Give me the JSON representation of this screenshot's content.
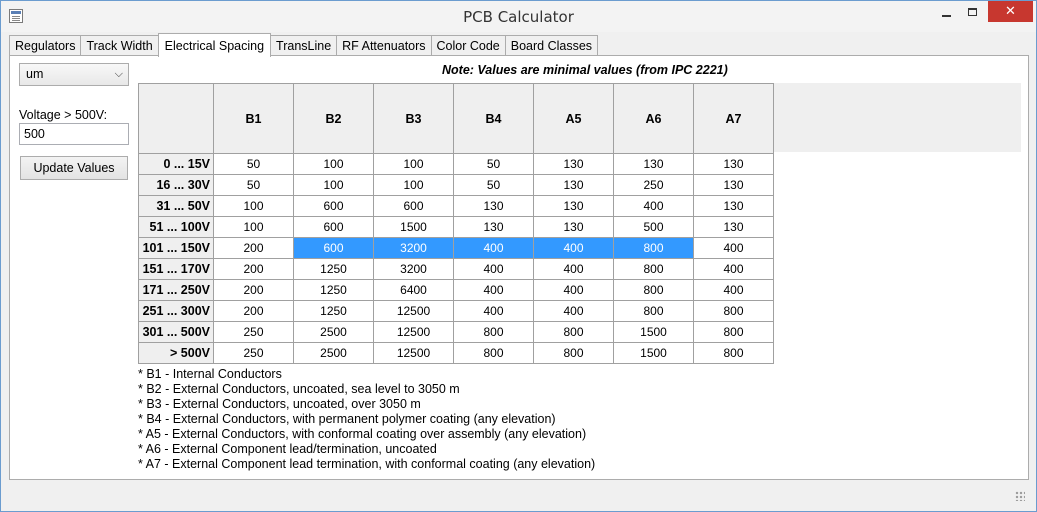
{
  "window": {
    "title": "PCB Calculator"
  },
  "tabs": [
    "Regulators",
    "Track Width",
    "Electrical Spacing",
    "TransLine",
    "RF Attenuators",
    "Color Code",
    "Board Classes"
  ],
  "active_tab": "Electrical Spacing",
  "controls": {
    "unit_value": "um",
    "voltage_label": "Voltage > 500V:",
    "voltage_value": "500",
    "update_label": "Update Values"
  },
  "note": "Note: Values are minimal values (from IPC 2221)",
  "table": {
    "columns": [
      "B1",
      "B2",
      "B3",
      "B4",
      "A5",
      "A6",
      "A7"
    ],
    "rows": [
      {
        "label": "0 ... 15V",
        "values": [
          "50",
          "100",
          "100",
          "50",
          "130",
          "130",
          "130"
        ]
      },
      {
        "label": "16 ... 30V",
        "values": [
          "50",
          "100",
          "100",
          "50",
          "130",
          "250",
          "130"
        ]
      },
      {
        "label": "31 ... 50V",
        "values": [
          "100",
          "600",
          "600",
          "130",
          "130",
          "400",
          "130"
        ]
      },
      {
        "label": "51 ... 100V",
        "values": [
          "100",
          "600",
          "1500",
          "130",
          "130",
          "500",
          "130"
        ]
      },
      {
        "label": "101 ... 150V",
        "values": [
          "200",
          "600",
          "3200",
          "400",
          "400",
          "800",
          "400"
        ]
      },
      {
        "label": "151 ... 170V",
        "values": [
          "200",
          "1250",
          "3200",
          "400",
          "400",
          "800",
          "400"
        ]
      },
      {
        "label": "171 ... 250V",
        "values": [
          "200",
          "1250",
          "6400",
          "400",
          "400",
          "800",
          "400"
        ]
      },
      {
        "label": "251 ... 300V",
        "values": [
          "200",
          "1250",
          "12500",
          "400",
          "400",
          "800",
          "800"
        ]
      },
      {
        "label": "301 ... 500V",
        "values": [
          "250",
          "2500",
          "12500",
          "800",
          "800",
          "1500",
          "800"
        ]
      },
      {
        "label": "> 500V",
        "values": [
          "250",
          "2500",
          "12500",
          "800",
          "800",
          "1500",
          "800"
        ]
      }
    ],
    "selection": {
      "row": 4,
      "from_col": 1,
      "to_col": 5,
      "current_col": 5
    }
  },
  "legend": [
    "*  B1 - Internal Conductors",
    "*  B2 - External Conductors, uncoated, sea level to 3050 m",
    "*  B3 - External Conductors, uncoated, over 3050 m",
    "*  B4 - External Conductors, with permanent polymer coating (any elevation)",
    "*  A5 - External Conductors, with conformal coating over assembly (any elevation)",
    "*  A6 - External Component lead/termination, uncoated",
    "*  A7 - External Component lead termination, with conformal coating (any elevation)"
  ],
  "colors": {
    "selection": "#3399ff",
    "close_button": "#c7372f",
    "header_bg": "#efefef"
  }
}
